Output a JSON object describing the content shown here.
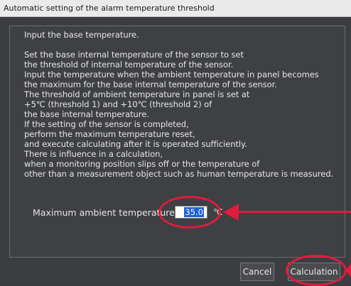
{
  "window": {
    "title": "Automatic setting of the alarm temperature threshold"
  },
  "body": {
    "heading": "Input the base temperature.",
    "lines": [
      "Set the base internal temperature of the sensor to set",
      "the threshold of internal temperature of the sensor.",
      "Input the temperature when the ambient temperature in panel becomes",
      "the maximum for the base internal temperature of the sensor.",
      "The threshold of ambient temperature in panel is set at",
      "+5℃ (threshold 1) and +10℃ (threshold 2) of",
      "the base internal temperature.",
      "If the setting of the sensor is completed,",
      "perform the maximum temperature reset,",
      "and execute calculating after it is operated sufficiently.",
      "There is influence in a calculation,",
      "when a monitoring position slips off or the temperature of",
      "other than a measurement object such as human temperature is measured."
    ]
  },
  "temperature": {
    "label": "Maximum ambient temperature",
    "value": "35.0",
    "unit": "℃"
  },
  "buttons": {
    "cancel": "Cancel",
    "calculation": "Calculation"
  },
  "colors": {
    "annotation": "#e01b3d",
    "selection": "#1f61d6"
  }
}
